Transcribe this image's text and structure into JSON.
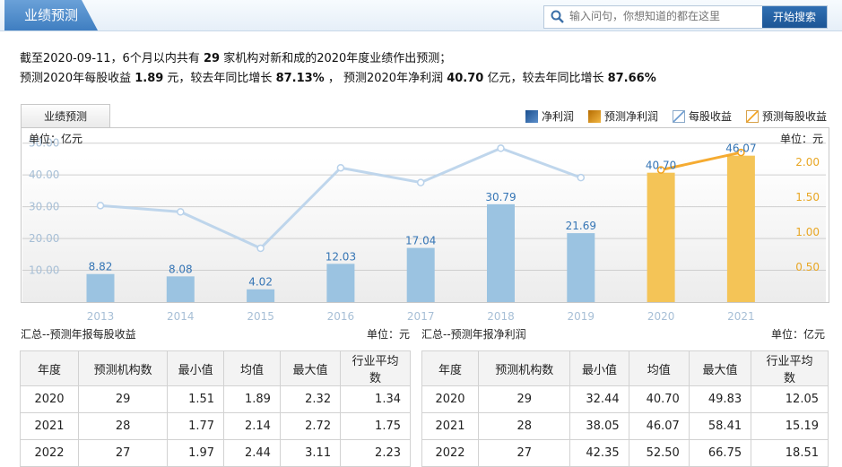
{
  "header": {
    "title": "业绩预测",
    "search_placeholder": "输入问句，你想知道的都在这里",
    "search_button": "开始搜索"
  },
  "summary": {
    "l1a": "截至2020-09-11，6个月以内共有 ",
    "l1b": "29",
    "l1c": " 家机构对新和成的2020年度业绩作出预测；",
    "l2a": "预测2020年每股收益 ",
    "l2b": "1.89",
    "l2c": " 元，较去年同比增长 ",
    "l2d": "87.13%",
    "l2e": " ， 预测2020年净利润 ",
    "l2f": "40.70",
    "l2g": " 亿元，较去年同比增长 ",
    "l2h": "87.66%"
  },
  "tab_label": "业绩预测",
  "legend": {
    "net_profit": "净利润",
    "forecast_net_profit": "预测净利润",
    "eps": "每股收益",
    "forecast_eps": "预测每股收益"
  },
  "colors": {
    "actual_bar": "#9bc3e1",
    "forecast_bar": "#f4c457",
    "eps_line": "#b8d1ea",
    "forecast_eps_line": "#f4a21b",
    "bar_label": "#3575b5"
  },
  "chart_data": {
    "type": "bar",
    "categories": [
      "2013",
      "2014",
      "2015",
      "2016",
      "2017",
      "2018",
      "2019",
      "2020",
      "2021"
    ],
    "left_unit": "单位：亿元",
    "right_unit": "单位：元",
    "series": [
      {
        "name": "净利润",
        "values": [
          8.82,
          8.08,
          4.02,
          12.03,
          17.04,
          30.79,
          21.69,
          null,
          null
        ]
      },
      {
        "name": "预测净利润",
        "values": [
          null,
          null,
          null,
          null,
          null,
          null,
          null,
          40.7,
          46.07
        ]
      },
      {
        "name": "每股收益",
        "type": "line",
        "values": [
          1.38,
          1.29,
          0.77,
          1.92,
          1.71,
          2.2,
          1.78,
          null,
          null
        ]
      },
      {
        "name": "预测每股收益",
        "type": "line",
        "values": [
          null,
          null,
          null,
          null,
          null,
          null,
          null,
          1.89,
          2.14
        ]
      }
    ],
    "y_left_ticks": [
      "10.00",
      "20.00",
      "30.00",
      "40.00",
      "50.00"
    ],
    "y_left_range": [
      0,
      55
    ],
    "y_right_ticks": [
      "0.50",
      "1.00",
      "1.50",
      "2.00"
    ],
    "y_right_range": [
      0,
      2.5
    ],
    "grid": true
  },
  "eps_table": {
    "title": "汇总--预测年报每股收益",
    "unit": "单位：元",
    "headers": [
      "年度",
      "预测机构数",
      "最小值",
      "均值",
      "最大值",
      "行业平均数"
    ],
    "rows": [
      [
        "2020",
        "29",
        "1.51",
        "1.89",
        "2.32",
        "1.34"
      ],
      [
        "2021",
        "28",
        "1.77",
        "2.14",
        "2.72",
        "1.75"
      ],
      [
        "2022",
        "27",
        "1.97",
        "2.44",
        "3.11",
        "2.23"
      ]
    ]
  },
  "np_table": {
    "title": "汇总--预测年报净利润",
    "unit": "单位：亿元",
    "headers": [
      "年度",
      "预测机构数",
      "最小值",
      "均值",
      "最大值",
      "行业平均数"
    ],
    "rows": [
      [
        "2020",
        "29",
        "32.44",
        "40.70",
        "49.83",
        "12.05"
      ],
      [
        "2021",
        "28",
        "38.05",
        "46.07",
        "58.41",
        "15.19"
      ],
      [
        "2022",
        "27",
        "42.35",
        "52.50",
        "66.75",
        "18.51"
      ]
    ]
  }
}
